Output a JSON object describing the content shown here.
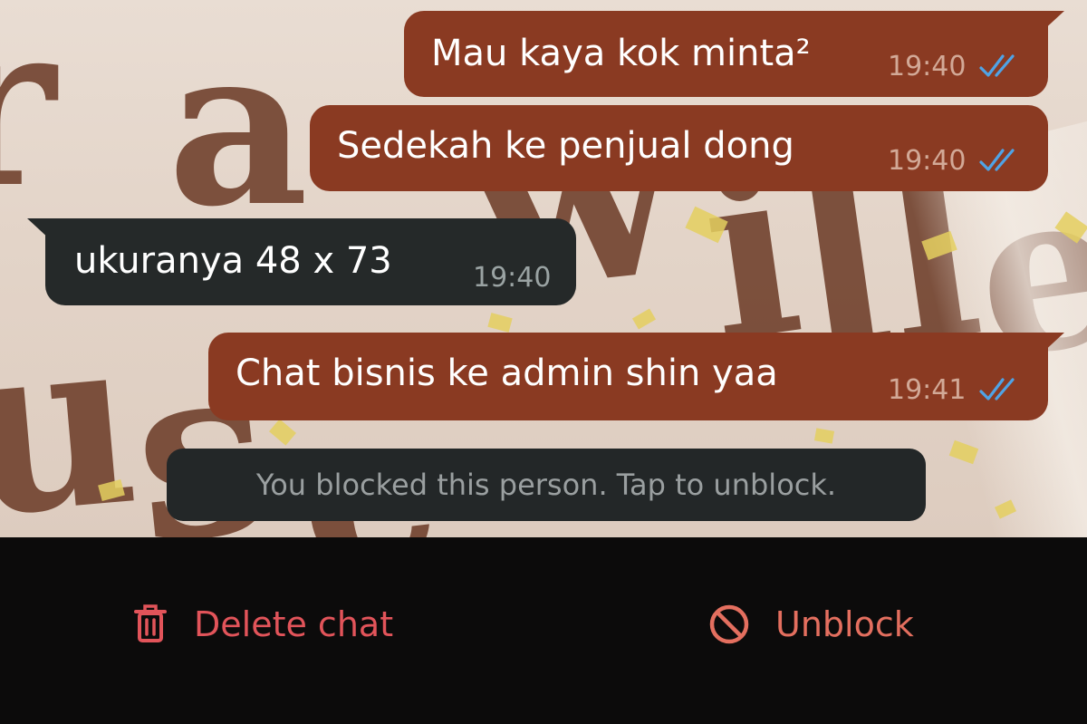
{
  "messages": [
    {
      "direction": "outgoing",
      "text": "Mau kaya kok minta²",
      "time": "19:40",
      "read": true
    },
    {
      "direction": "outgoing",
      "text": "Sedekah ke penjual dong",
      "time": "19:40",
      "read": true
    },
    {
      "direction": "incoming",
      "text": "ukuranya 48 x 73",
      "time": "19:40"
    },
    {
      "direction": "outgoing",
      "text": "Chat bisnis ke admin shin yaa",
      "time": "19:41",
      "read": true
    }
  ],
  "blocked_notice": "You blocked this person. Tap to unblock.",
  "actions": {
    "delete": {
      "label": "Delete chat",
      "icon": "trash-icon"
    },
    "unblock": {
      "label": "Unblock",
      "icon": "block-icon"
    }
  },
  "colors": {
    "outgoing_bubble": "#8a3a22",
    "incoming_bubble": "#252929",
    "read_ticks": "#4fa3e6",
    "delete_accent": "#e2545a",
    "unblock_accent": "#e46f5f",
    "bottom_bar": "#0c0b0b"
  }
}
